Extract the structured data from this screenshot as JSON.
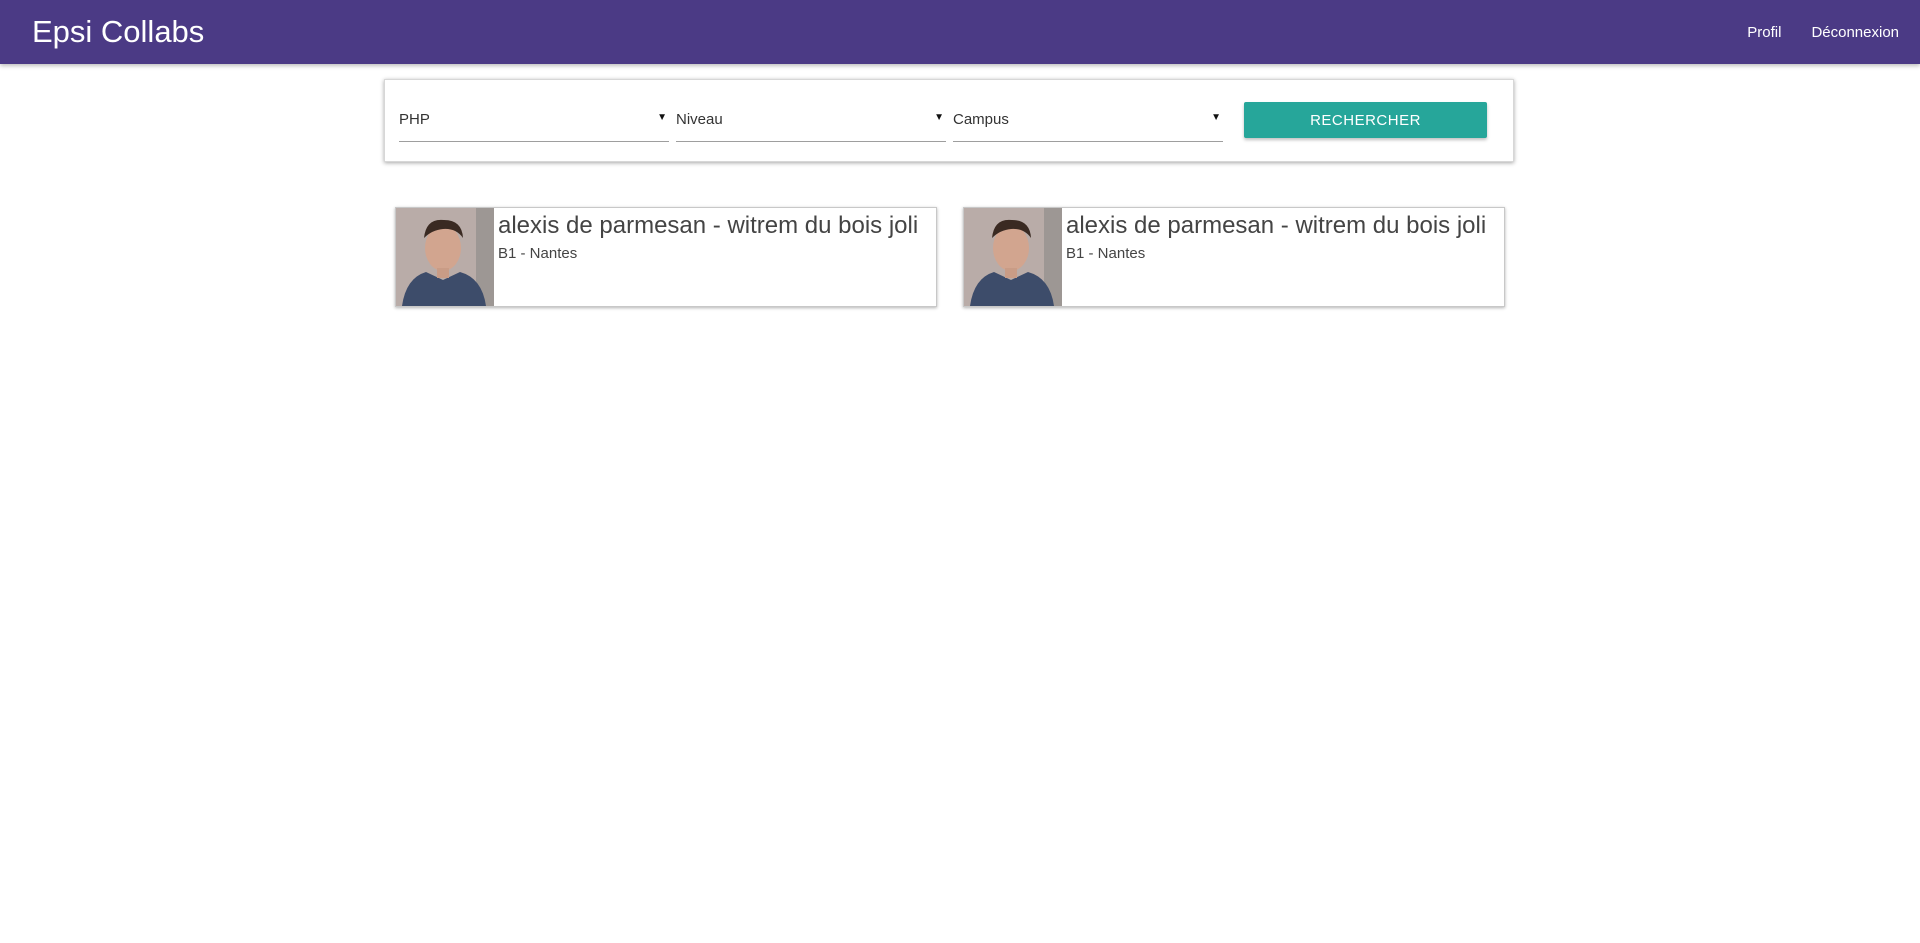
{
  "header": {
    "brand": "Epsi Collabs",
    "links": [
      {
        "label": "Profil"
      },
      {
        "label": "Déconnexion"
      }
    ]
  },
  "search": {
    "selects": [
      {
        "value": "PHP"
      },
      {
        "value": "Niveau"
      },
      {
        "value": "Campus"
      }
    ],
    "button_label": "RECHERCHER",
    "button_color": "#26a69a"
  },
  "results": [
    {
      "name": "alexis de parmesan - witrem du bois joli",
      "meta": "B1 - Nantes"
    },
    {
      "name": "alexis de parmesan - witrem du bois joli",
      "meta": "B1 - Nantes"
    }
  ],
  "colors": {
    "navbar": "#4b3a85",
    "accent": "#26a69a"
  },
  "icons": {
    "select_caret": "caret-down-icon"
  }
}
